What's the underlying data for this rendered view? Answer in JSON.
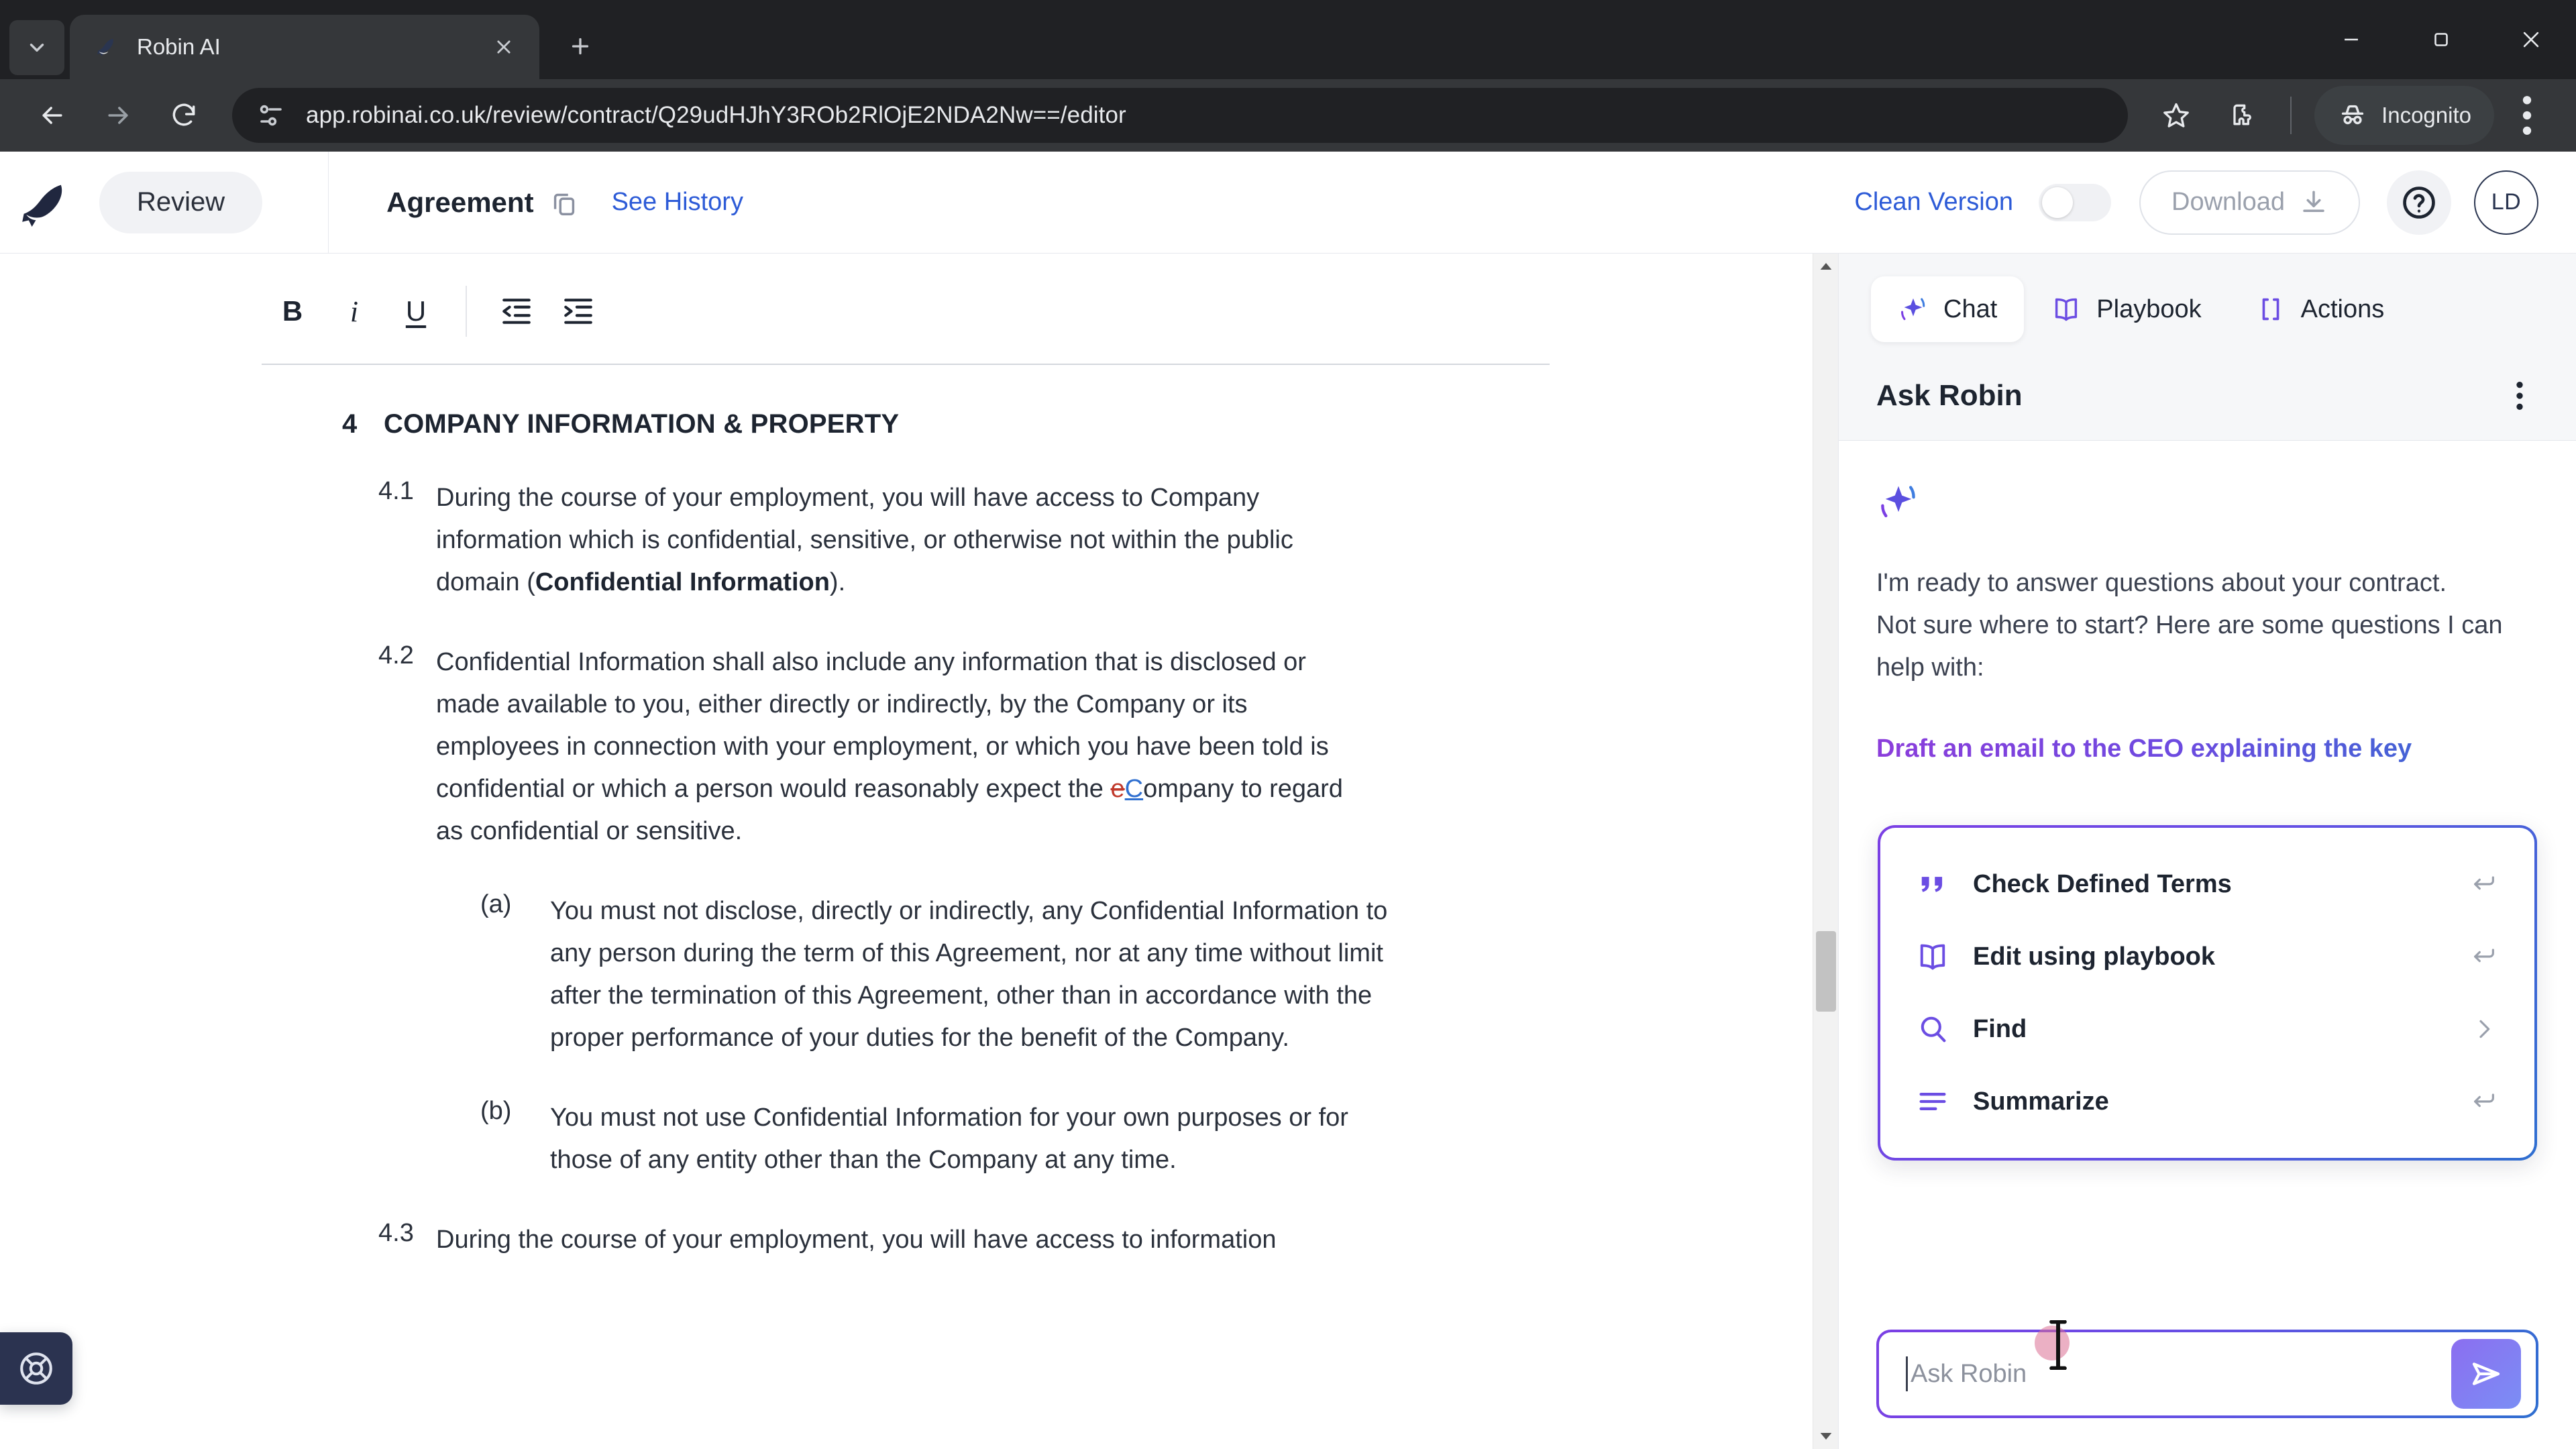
{
  "browser": {
    "tab": {
      "title": "Robin AI",
      "favicon_icon": "robin-bird-icon"
    },
    "new_tab_label": "+",
    "url": "app.robinai.co.uk/review/contract/Q29udHJhY3ROb2RlOjE2NDA2Nw==/editor",
    "profile_chip": "Incognito",
    "icons": {
      "back": "back-arrow-icon",
      "forward": "forward-arrow-icon",
      "reload": "reload-icon",
      "site_info": "site-settings-icon",
      "bookmark": "star-icon",
      "extensions": "extensions-puzzle-icon",
      "incognito": "incognito-hat-icon",
      "menu": "three-dots-menu-icon",
      "minimize": "minimize-icon",
      "maximize": "maximize-icon",
      "close": "close-icon",
      "tab_search": "chevron-down-icon"
    }
  },
  "app_header": {
    "logo": "robin-bird-logo",
    "review_label": "Review",
    "doc_title": "Agreement",
    "copy_icon": "copy-icon",
    "see_history": "See History",
    "clean_version_label": "Clean Version",
    "clean_version_on": false,
    "download_label": "Download",
    "download_icon": "download-icon",
    "help_icon": "question-circle-icon",
    "avatar_initials": "LD"
  },
  "editor": {
    "toolbar": [
      {
        "name": "bold",
        "label": "B"
      },
      {
        "name": "italic",
        "label": "i"
      },
      {
        "name": "underline",
        "label": "U"
      },
      {
        "name": "outdent",
        "label": ""
      },
      {
        "name": "indent",
        "label": ""
      }
    ],
    "clause": {
      "number": "4",
      "heading": "COMPANY INFORMATION & PROPERTY"
    },
    "paragraphs": [
      {
        "number": "4.1",
        "text_before": "During the course of your employment, you will have access to Company information which is confidential, sensitive, or otherwise not within the public domain (",
        "bold": "Confidential Information",
        "text_after": ")."
      },
      {
        "number": "4.2",
        "text_before": "Confidential Information shall also include any information that is disclosed or made available to you, either directly or indirectly, by the Company or its employees in connection with your employment, or which you have been told is confidential or which a person would reasonably expect the ",
        "deleted": "e",
        "inserted": "C",
        "text_after": "ompany to regard as confidential or sensitive."
      }
    ],
    "subparagraphs": [
      {
        "number": "(a)",
        "text": "You must not disclose, directly or indirectly, any Confidential Information to any person during the term of this Agreement, nor at any time without limit after the termination of this Agreement, other than in accordance with the proper performance of your duties for the benefit of the Company."
      },
      {
        "number": "(b)",
        "text": "You must not use Confidential Information for your own purposes or for those of any entity other than the Company at any time."
      }
    ],
    "last_paragraph": {
      "number": "4.3",
      "text": "During the course of your employment, you will have access to information"
    }
  },
  "chat_panel": {
    "tabs": [
      {
        "label": "Chat",
        "icon": "sparkle-icon",
        "active": true
      },
      {
        "label": "Playbook",
        "icon": "book-icon",
        "active": false
      },
      {
        "label": "Actions",
        "icon": "brackets-icon",
        "active": false
      }
    ],
    "header_title": "Ask Robin",
    "kebab_icon": "three-dots-vertical-icon",
    "message": {
      "spark_icon": "sparkle-icon",
      "line1": "I'm ready to answer questions about your contract.",
      "line2": "Not sure where to start? Here are some questions I can help with:",
      "suggestion": "Draft an email to the CEO explaining the key"
    },
    "command_menu": [
      {
        "label": "Check Defined Terms",
        "icon": "quote-icon",
        "action_icon": "enter-return-icon"
      },
      {
        "label": "Edit using playbook",
        "icon": "book-icon",
        "action_icon": "enter-return-icon"
      },
      {
        "label": "Find",
        "icon": "search-icon",
        "action_icon": "chevron-right-icon"
      },
      {
        "label": "Summarize",
        "icon": "list-lines-icon",
        "action_icon": "enter-return-icon"
      }
    ],
    "input": {
      "value": "",
      "placeholder": "Ask Robin",
      "send_icon": "send-paper-plane-icon"
    }
  },
  "support_widget": {
    "icon": "lifebuoy-icon"
  },
  "colors": {
    "brand_navy": "#2a3550",
    "link_blue": "#2d5bd7",
    "accent_purple": "#7b3fe4",
    "accent_blue": "#2f6fd0",
    "deletion_red": "#c0392b",
    "insertion_blue": "#2f6fd0",
    "chrome_dark": "#202124"
  }
}
